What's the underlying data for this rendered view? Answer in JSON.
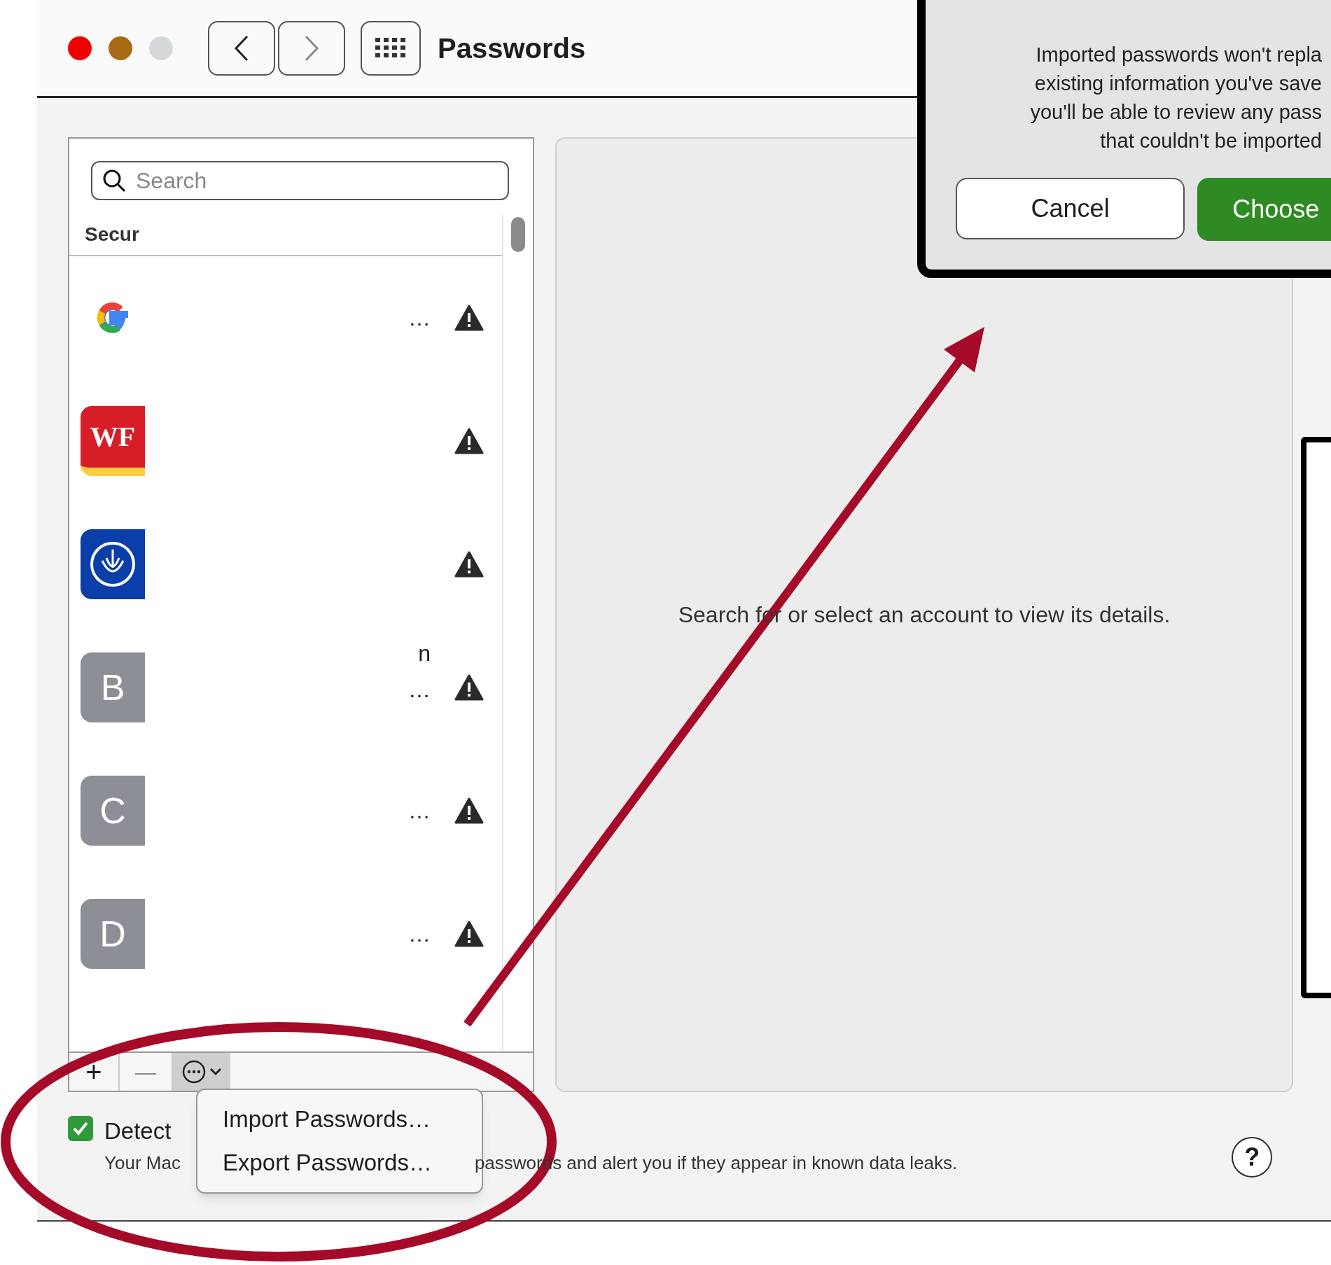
{
  "window": {
    "title": "Passwords"
  },
  "sidebar": {
    "search_placeholder": "Search",
    "section_header": "Secur",
    "rows": [
      {
        "kind": "google",
        "top_fragment": "",
        "mid_fragment": "…",
        "warning": true
      },
      {
        "kind": "wf",
        "letter": "WF",
        "mid_fragment": "",
        "warning": true
      },
      {
        "kind": "allstate",
        "mid_fragment": "",
        "warning": true
      },
      {
        "kind": "letter",
        "letter": "B",
        "top_fragment": "n",
        "mid_fragment": "…",
        "warning": true
      },
      {
        "kind": "letter",
        "letter": "C",
        "mid_fragment": "…",
        "warning": true
      },
      {
        "kind": "letter",
        "letter": "D",
        "mid_fragment": "…",
        "warning": true
      }
    ],
    "toolbar": {
      "add": "+",
      "remove": "—"
    }
  },
  "detail": {
    "empty_message": "Search for or select an account to view its details."
  },
  "menu": {
    "items": [
      "Import Passwords…",
      "Export Passwords…"
    ]
  },
  "footer": {
    "checked": true,
    "label": "Detect",
    "description_start": "Your Mac",
    "description_end": "passwords and alert you if they appear in known data leaks.",
    "help": "?"
  },
  "dialog": {
    "lines": [
      "Imported passwords won't repla",
      "existing information you've save",
      "you'll be able to review any pass",
      "that couldn't be imported"
    ],
    "cancel": "Cancel",
    "choose": "Choose"
  }
}
